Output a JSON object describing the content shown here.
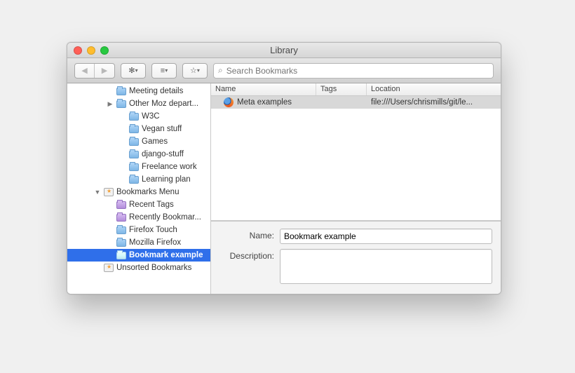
{
  "window": {
    "title": "Library"
  },
  "search": {
    "placeholder": "Search Bookmarks"
  },
  "sidebar": {
    "items": [
      {
        "label": "Meeting details",
        "icon": "folder",
        "indent": 70,
        "disclosure": ""
      },
      {
        "label": "Other Moz depart...",
        "icon": "folder",
        "indent": 70,
        "disclosure": "▶"
      },
      {
        "label": "W3C",
        "icon": "folder",
        "indent": 88,
        "disclosure": ""
      },
      {
        "label": "Vegan stuff",
        "icon": "folder",
        "indent": 88,
        "disclosure": ""
      },
      {
        "label": "Games",
        "icon": "folder",
        "indent": 88,
        "disclosure": ""
      },
      {
        "label": "django-stuff",
        "icon": "folder",
        "indent": 88,
        "disclosure": ""
      },
      {
        "label": "Freelance work",
        "icon": "folder",
        "indent": 88,
        "disclosure": ""
      },
      {
        "label": "Learning plan",
        "icon": "folder",
        "indent": 88,
        "disclosure": ""
      },
      {
        "label": "Bookmarks Menu",
        "icon": "menu",
        "indent": 52,
        "disclosure": "▼"
      },
      {
        "label": "Recent Tags",
        "icon": "smart",
        "indent": 70,
        "disclosure": ""
      },
      {
        "label": "Recently Bookmar...",
        "icon": "smart",
        "indent": 70,
        "disclosure": ""
      },
      {
        "label": "Firefox Touch",
        "icon": "folder",
        "indent": 70,
        "disclosure": ""
      },
      {
        "label": "Mozilla Firefox",
        "icon": "folder",
        "indent": 70,
        "disclosure": ""
      },
      {
        "label": "Bookmark example",
        "icon": "folder",
        "indent": 70,
        "disclosure": "",
        "selected": true
      },
      {
        "label": "Unsorted Bookmarks",
        "icon": "unsorted",
        "indent": 52,
        "disclosure": ""
      }
    ]
  },
  "columns": {
    "name": "Name",
    "tags": "Tags",
    "location": "Location"
  },
  "rows": [
    {
      "name": "Meta examples",
      "tags": "",
      "location": "file:///Users/chrismills/git/le..."
    }
  ],
  "detail": {
    "name_label": "Name:",
    "name_value": "Bookmark example",
    "desc_label": "Description:",
    "desc_value": ""
  }
}
